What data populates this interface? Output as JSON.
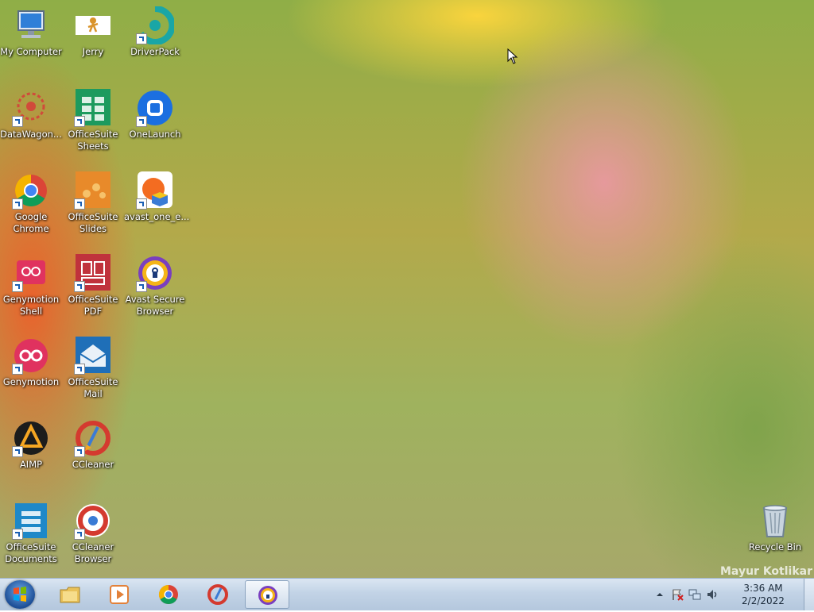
{
  "desktop": {
    "icons": [
      {
        "label": "My Computer"
      },
      {
        "label": "Jerry"
      },
      {
        "label": "DriverPack"
      },
      {
        "label": "DataWagon..."
      },
      {
        "label": "OfficeSuite Sheets"
      },
      {
        "label": "OneLaunch"
      },
      {
        "label": "Google Chrome"
      },
      {
        "label": "OfficeSuite Slides"
      },
      {
        "label": "avast_one_e..."
      },
      {
        "label": "Genymotion Shell"
      },
      {
        "label": "OfficeSuite PDF"
      },
      {
        "label": "Avast Secure Browser"
      },
      {
        "label": "Genymotion"
      },
      {
        "label": "OfficeSuite Mail"
      },
      {
        "label": "AIMP"
      },
      {
        "label": "CCleaner"
      },
      {
        "label": "OfficeSuite Documents"
      },
      {
        "label": "CCleaner Browser"
      },
      {
        "label": "Recycle Bin"
      }
    ],
    "watermark": "Mayur Kotlikar"
  },
  "taskbar": {
    "pinned": [
      "explorer-icon",
      "media-player-icon",
      "chrome-icon",
      "ccleaner-icon",
      "avast-browser-icon"
    ],
    "clock": {
      "time": "3:36 AM",
      "date": "2/2/2022"
    }
  },
  "colors": {
    "taskbar": "#c2d3e6",
    "start": "#1d4e96"
  }
}
